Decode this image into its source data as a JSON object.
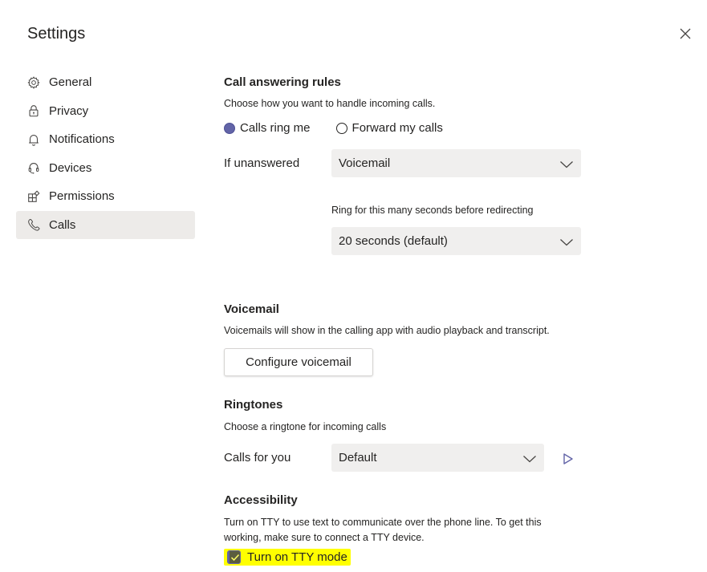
{
  "header": {
    "title": "Settings",
    "close_icon": "close-icon"
  },
  "sidebar": {
    "items": [
      {
        "label": "General",
        "icon": "gear-icon",
        "active": false
      },
      {
        "label": "Privacy",
        "icon": "lock-icon",
        "active": false
      },
      {
        "label": "Notifications",
        "icon": "bell-icon",
        "active": false
      },
      {
        "label": "Devices",
        "icon": "headset-icon",
        "active": false
      },
      {
        "label": "Permissions",
        "icon": "apps-icon",
        "active": false
      },
      {
        "label": "Calls",
        "icon": "phone-icon",
        "active": true
      }
    ]
  },
  "call_answering": {
    "title": "Call answering rules",
    "description": "Choose how you want to handle incoming calls.",
    "options": [
      {
        "label": "Calls ring me",
        "selected": true
      },
      {
        "label": "Forward my calls",
        "selected": false
      }
    ],
    "if_unanswered_label": "If unanswered",
    "if_unanswered_value": "Voicemail",
    "ring_label": "Ring for this many seconds before redirecting",
    "ring_value": "20 seconds (default)"
  },
  "voicemail": {
    "title": "Voicemail",
    "description": "Voicemails will show in the calling app with audio playback and transcript.",
    "configure_button": "Configure voicemail"
  },
  "ringtones": {
    "title": "Ringtones",
    "description": "Choose a ringtone for incoming calls",
    "calls_for_you_label": "Calls for you",
    "calls_for_you_value": "Default",
    "play_icon": "play-icon"
  },
  "accessibility": {
    "title": "Accessibility",
    "description_line1": "Turn on TTY to use text to communicate over the phone line. To get this",
    "description_line2": "working, make sure to connect a TTY device.",
    "tty_label": "Turn on TTY mode",
    "tty_checked": true,
    "highlight_color": "#ffff00"
  },
  "colors": {
    "accent": "#6264a7",
    "dropdown_bg": "#f0efee",
    "active_nav_bg": "#edebe9"
  }
}
